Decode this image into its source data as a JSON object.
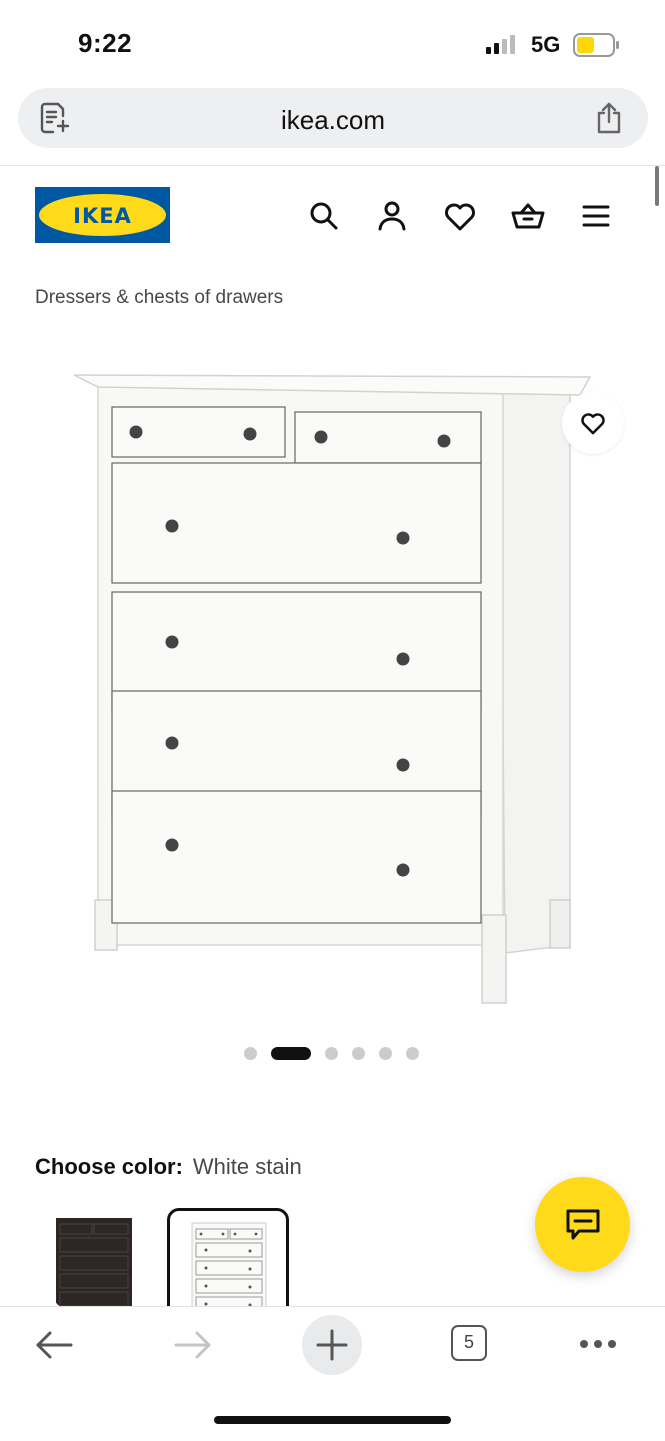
{
  "status_bar": {
    "time": "9:22",
    "network": "5G"
  },
  "browser": {
    "url": "ikea.com"
  },
  "header": {
    "logo_text": "IKEA"
  },
  "breadcrumb": "Dressers & chests of drawers",
  "product": {
    "carousel": {
      "total": 6,
      "active_index": 1
    }
  },
  "color_choice": {
    "label": "Choose color:",
    "value": "White stain"
  },
  "toolbar": {
    "tab_count": "5"
  },
  "colors": {
    "ikea_blue": "#0058a3",
    "ikea_yellow": "#ffda1a"
  }
}
